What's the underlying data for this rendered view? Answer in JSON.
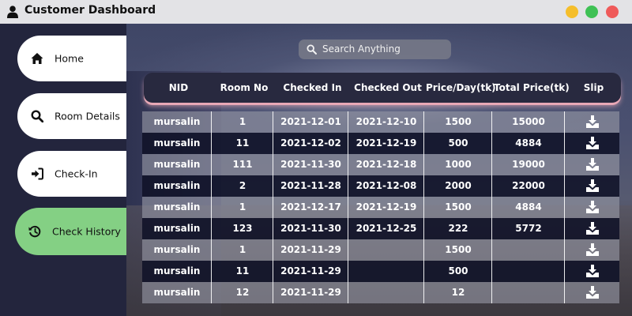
{
  "window": {
    "title": "Customer Dashboard",
    "icon": "user-icon",
    "controls": [
      "minimize",
      "maximize",
      "close"
    ]
  },
  "sidebar": {
    "items": [
      {
        "label": "Home",
        "icon": "home-icon"
      },
      {
        "label": "Room Details",
        "icon": "search-icon"
      },
      {
        "label": "Check-In",
        "icon": "sign-in-icon"
      },
      {
        "label": "Check History",
        "icon": "history-icon",
        "active": true
      }
    ]
  },
  "search": {
    "placeholder": "Search Anything"
  },
  "table": {
    "columns": [
      "NID",
      "Room No",
      "Checked In",
      "Checked Out",
      "Price/Day(tk)",
      "Total Price(tk)",
      "Slip"
    ],
    "rows": [
      {
        "nid": "mursalin",
        "room": "1",
        "checked_in": "2021-12-01",
        "checked_out": "2021-12-10",
        "price": "1500",
        "total": "15000"
      },
      {
        "nid": "mursalin",
        "room": "11",
        "checked_in": "2021-12-02",
        "checked_out": "2021-12-19",
        "price": "500",
        "total": "4884"
      },
      {
        "nid": "mursalin",
        "room": "111",
        "checked_in": "2021-11-30",
        "checked_out": "2021-12-18",
        "price": "1000",
        "total": "19000"
      },
      {
        "nid": "mursalin",
        "room": "2",
        "checked_in": "2021-11-28",
        "checked_out": "2021-12-08",
        "price": "2000",
        "total": "22000"
      },
      {
        "nid": "mursalin",
        "room": "1",
        "checked_in": "2021-12-17",
        "checked_out": "2021-12-19",
        "price": "1500",
        "total": "4884"
      },
      {
        "nid": "mursalin",
        "room": "123",
        "checked_in": "2021-11-30",
        "checked_out": "2021-12-25",
        "price": "222",
        "total": "5772"
      },
      {
        "nid": "mursalin",
        "room": "1",
        "checked_in": "2021-11-29",
        "checked_out": "",
        "price": "1500",
        "total": ""
      },
      {
        "nid": "mursalin",
        "room": "11",
        "checked_in": "2021-11-29",
        "checked_out": "",
        "price": "500",
        "total": ""
      },
      {
        "nid": "mursalin",
        "room": "12",
        "checked_in": "2021-11-29",
        "checked_out": "",
        "price": "12",
        "total": ""
      }
    ],
    "slip_icon": "download-icon"
  }
}
